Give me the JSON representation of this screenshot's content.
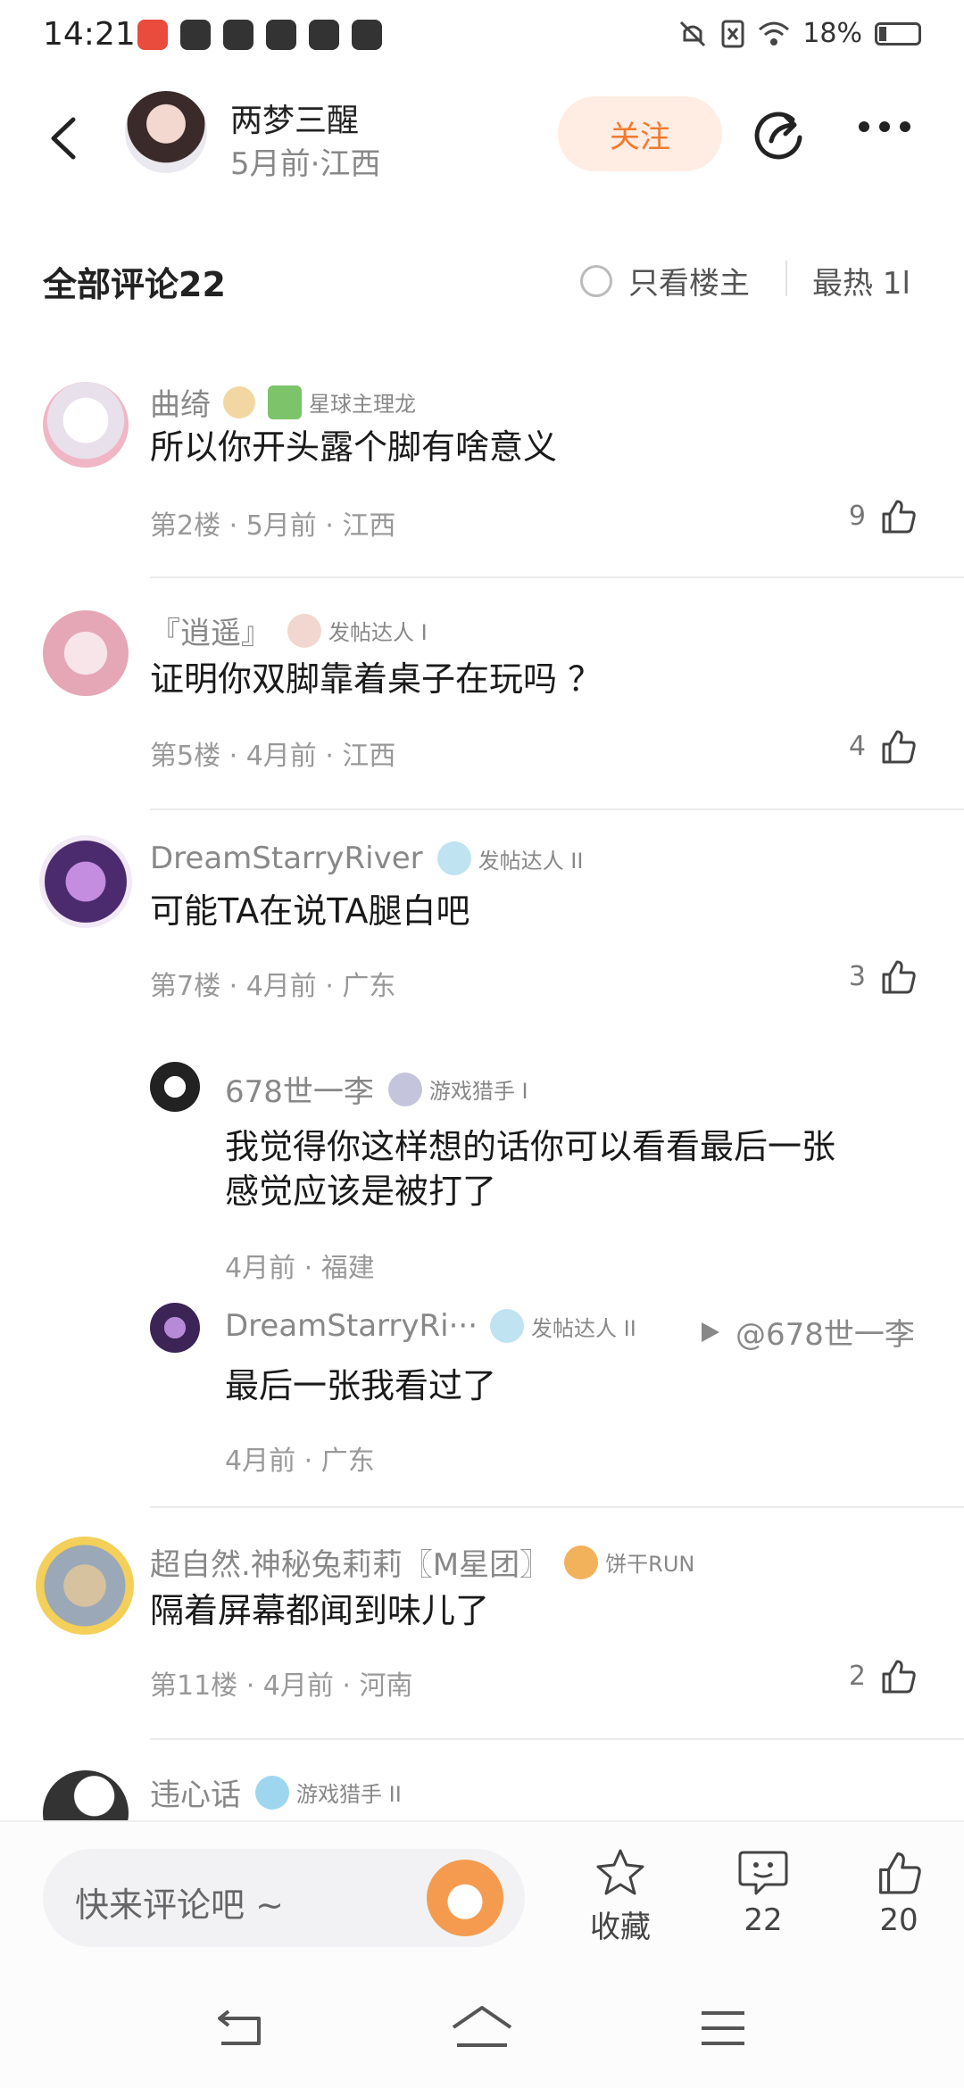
{
  "status_bar": {
    "time": "14:21",
    "battery": "18%"
  },
  "header": {
    "author_name": "两梦三醒",
    "author_meta": "5月前·江西",
    "follow_label": "关注"
  },
  "filter": {
    "all_comments": "全部评论22",
    "only_op": "只看楼主",
    "sort": "最热 1l"
  },
  "comments": [
    {
      "user": "曲绮",
      "badge": "星球主理龙",
      "text": "所以你开头露个脚有啥意义",
      "meta": "第2楼 · 5月前 · 江西",
      "likes": "9"
    },
    {
      "user": "『逍遥』",
      "badge": "发帖达人 I",
      "text": "证明你双脚靠着桌子在玩吗 ？",
      "meta": "第5楼 · 4月前 · 江西",
      "likes": "4"
    },
    {
      "user": "DreamStarryRiver",
      "badge": "发帖达人 II",
      "text": "可能TA在说TA腿白吧",
      "meta": "第7楼 · 4月前 · 广东",
      "likes": "3"
    },
    {
      "user": "超自然.神秘兔莉莉〖M星团〗",
      "badge": "饼干RUN",
      "text": "隔着屏幕都闻到味儿了",
      "meta": "第11楼 · 4月前 · 河南",
      "likes": "2"
    },
    {
      "user": "违心话",
      "badge": "游戏猎手 II"
    }
  ],
  "replies": [
    {
      "user": "678世一李",
      "badge": "游戏猎手 I",
      "text_line1": "我觉得你这样想的话你可以看看最后一张",
      "text_line2": "感觉应该是被打了",
      "meta": "4月前 · 福建"
    },
    {
      "user": "DreamStarryRi···",
      "badge": "发帖达人 II",
      "reply_to": "@678世一李",
      "text": "最后一张我看过了",
      "meta": "4月前 · 广东"
    }
  ],
  "bottom": {
    "input_placeholder": "快来评论吧 ~",
    "collect_label": "收藏",
    "comment_count": "22",
    "like_count": "20"
  },
  "colors": {
    "accent": "#f07a2e",
    "follow_bg": "#ffece2",
    "meta_gray": "#999999"
  }
}
